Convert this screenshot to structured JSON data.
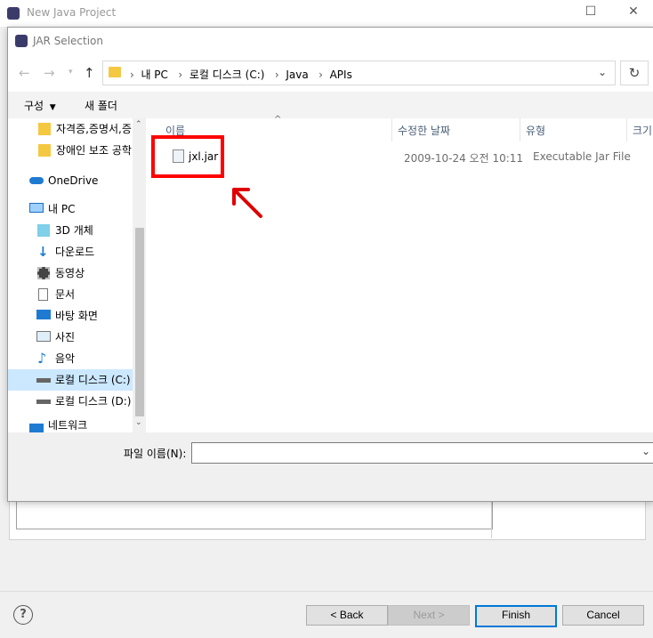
{
  "background_window": {
    "title": "New Java Project",
    "buttons": {
      "back": "< Back",
      "next": "Next >",
      "finish": "Finish",
      "cancel": "Cancel"
    },
    "help": "?"
  },
  "dialog": {
    "title": "JAR Selection",
    "breadcrumb": [
      "내 PC",
      "로컬 디스크 (C:)",
      "Java",
      "APIs"
    ],
    "toolbar": {
      "organize": "구성",
      "new_folder": "새 폴더"
    },
    "sidebar": [
      {
        "label": "자격증,증명서,증",
        "icon": "folder-icon",
        "indent": 2
      },
      {
        "label": "장애인 보조 공학",
        "icon": "folder-icon",
        "indent": 2
      },
      {
        "label": "OneDrive",
        "icon": "cloud-icon",
        "indent": 1
      },
      {
        "label": "내 PC",
        "icon": "pc-icon",
        "indent": 1
      },
      {
        "label": "3D 개체",
        "icon": "cube-icon",
        "indent": 2
      },
      {
        "label": "다운로드",
        "icon": "download-icon",
        "indent": 2
      },
      {
        "label": "동영상",
        "icon": "video-icon",
        "indent": 2
      },
      {
        "label": "문서",
        "icon": "document-icon",
        "indent": 2
      },
      {
        "label": "바탕 화면",
        "icon": "desktop-icon",
        "indent": 2
      },
      {
        "label": "사진",
        "icon": "picture-icon",
        "indent": 2
      },
      {
        "label": "음악",
        "icon": "music-icon",
        "indent": 2
      },
      {
        "label": "로컬 디스크 (C:)",
        "icon": "drive-icon",
        "indent": 2,
        "selected": true
      },
      {
        "label": "로컬 디스크 (D:)",
        "icon": "drive-icon",
        "indent": 2
      },
      {
        "label": "네트워크",
        "icon": "network-icon",
        "indent": 1
      }
    ],
    "columns": {
      "name": "이름",
      "date": "수정한 날짜",
      "type": "유형",
      "size": "크기"
    },
    "files": [
      {
        "name": "jxl.jar",
        "date": "2009-10-24 오전 10:11",
        "type": "Executable Jar File"
      }
    ],
    "filename_label": "파일 이름(N):",
    "filename_value": ""
  },
  "annotation": {
    "highlight_color": "#ff0000",
    "arrow_color": "#e00000"
  }
}
